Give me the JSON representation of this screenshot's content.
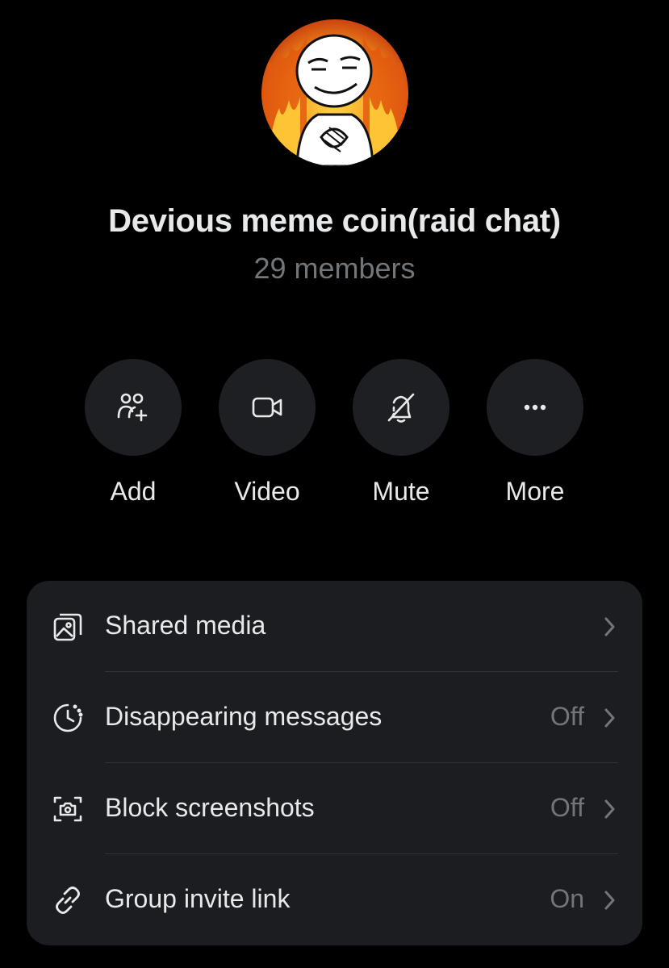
{
  "group": {
    "name": "Devious meme coin(raid chat)",
    "members": "29 members"
  },
  "actions": [
    {
      "label": "Add",
      "icon": "add-people-icon"
    },
    {
      "label": "Video",
      "icon": "video-camera-icon"
    },
    {
      "label": "Mute",
      "icon": "bell-off-icon"
    },
    {
      "label": "More",
      "icon": "ellipsis-icon"
    }
  ],
  "settings": [
    {
      "label": "Shared media",
      "value": "",
      "icon": "media-gallery-icon"
    },
    {
      "label": "Disappearing messages",
      "value": "Off",
      "icon": "timer-icon"
    },
    {
      "label": "Block screenshots",
      "value": "Off",
      "icon": "screenshot-camera-icon"
    },
    {
      "label": "Group invite link",
      "value": "On",
      "icon": "link-icon"
    }
  ],
  "colors": {
    "background": "#000000",
    "button_bg": "#1e1f23",
    "card_bg": "#1c1d21",
    "primary_text": "#e7e9ea",
    "secondary_text": "#71767b"
  }
}
